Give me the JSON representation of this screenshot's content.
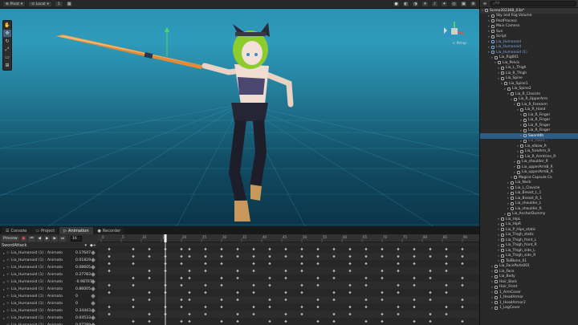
{
  "scene_toolbar": {
    "pivot_label": "Pivot",
    "space_label": "Local",
    "grid_value": "1"
  },
  "scene_view": {
    "perspective_label": "< Persp"
  },
  "anim_tabs": [
    {
      "label": "Console",
      "icon": "console-icon"
    },
    {
      "label": "Project",
      "icon": "folder-icon"
    },
    {
      "label": "Animation",
      "icon": "animation-icon"
    },
    {
      "label": "Recorder",
      "icon": "record-icon"
    }
  ],
  "anim_controls": {
    "preview_label": "Preview",
    "frame_value": "16",
    "clip_name": "SwordAttack"
  },
  "properties": [
    {
      "label": "Lia_Humanoid (1) : Animato",
      "value": "0.17647"
    },
    {
      "label": "Lia_Humanoid (1) : Animato",
      "value": "0.01829"
    },
    {
      "label": "Lia_Humanoid (1) : Animato",
      "value": "0.08605"
    },
    {
      "label": "Lia_Humanoid (1) : Animato",
      "value": "0.27783"
    },
    {
      "label": "Lia_Humanoid (1) : Animato",
      "value": "-0.98707"
    },
    {
      "label": "Lia_Humanoid (1) : Animato",
      "value": "0.86005"
    },
    {
      "label": "Lia_Humanoid (1) : Animato",
      "value": "0"
    },
    {
      "label": "Lia_Humanoid (1) : Animato",
      "value": "0"
    },
    {
      "label": "Lia_Humanoid (1) : Animato",
      "value": "0.34443"
    },
    {
      "label": "Lia_Humanoid (1) : Animato",
      "value": "0.04533"
    },
    {
      "label": "Lia_Humanoid (1) : Animato",
      "value": "0.07289"
    }
  ],
  "timeline": {
    "current_frame": 16,
    "ruler_ticks": [
      "0",
      "5",
      "10",
      "15",
      "20",
      "25",
      "30",
      "35",
      "40",
      "45",
      "50",
      "55",
      "60",
      "65",
      "70",
      "75",
      "80",
      "85",
      "90"
    ]
  },
  "hierarchy": {
    "search_placeholder": "All",
    "items": [
      {
        "label": "Scene20230B_03a*",
        "depth": 0,
        "kind": "scene"
      },
      {
        "label": "Sky and Fog Volume",
        "depth": 2,
        "kind": "normal"
      },
      {
        "label": "PostProcess",
        "depth": 2,
        "kind": "normal"
      },
      {
        "label": "Main Camera",
        "depth": 2,
        "kind": "normal"
      },
      {
        "label": "Sun",
        "depth": 2,
        "kind": "normal"
      },
      {
        "label": "Script",
        "depth": 2,
        "kind": "normal"
      },
      {
        "label": "Lia_Humanoid",
        "depth": 2,
        "kind": "blue"
      },
      {
        "label": "Lia_Humanoid",
        "depth": 2,
        "kind": "blue"
      },
      {
        "label": "Lia_Humanoid (1)",
        "depth": 2,
        "kind": "blue"
      },
      {
        "label": "Lia_Rig001",
        "depth": 3,
        "kind": "normal"
      },
      {
        "label": "Lia_Pelvis",
        "depth": 4,
        "kind": "normal"
      },
      {
        "label": "Lia_L_Thigh",
        "depth": 5,
        "kind": "normal"
      },
      {
        "label": "Lia_R_Thigh",
        "depth": 5,
        "kind": "normal"
      },
      {
        "label": "Lia_Spine",
        "depth": 5,
        "kind": "normal"
      },
      {
        "label": "Lia_Spine1",
        "depth": 6,
        "kind": "normal"
      },
      {
        "label": "Lia_Spine2",
        "depth": 7,
        "kind": "normal"
      },
      {
        "label": "Lia_R_Clavicle",
        "depth": 8,
        "kind": "normal"
      },
      {
        "label": "Lia_R_UpperArm",
        "depth": 9,
        "kind": "normal"
      },
      {
        "label": "Lia_R_Forearm",
        "depth": 10,
        "kind": "normal"
      },
      {
        "label": "Lia_R_Hand",
        "depth": 11,
        "kind": "normal"
      },
      {
        "label": "Lia_R_Finger",
        "depth": 12,
        "kind": "normal"
      },
      {
        "label": "Lia_R_Finger",
        "depth": 12,
        "kind": "normal"
      },
      {
        "label": "Lia_R_Finger",
        "depth": 12,
        "kind": "normal"
      },
      {
        "label": "Lia_R_Finger",
        "depth": 12,
        "kind": "normal"
      },
      {
        "label": "Sword4h",
        "depth": 12,
        "kind": "selected"
      },
      {
        "label": "Lia_Hand...",
        "depth": 12,
        "kind": "dim"
      },
      {
        "label": "Lia_elbow_R",
        "depth": 11,
        "kind": "normal"
      },
      {
        "label": "Lia_foreArm_R",
        "depth": 11,
        "kind": "normal"
      },
      {
        "label": "Lia_R_Armtrine_R",
        "depth": 11,
        "kind": "normal"
      },
      {
        "label": "Lia_shoulder_R",
        "depth": 10,
        "kind": "normal"
      },
      {
        "label": "Lia_upperArmB_R",
        "depth": 10,
        "kind": "normal"
      },
      {
        "label": "Lia_upperArmB_R",
        "depth": 10,
        "kind": "normal"
      },
      {
        "label": "Magica Capsule Co",
        "depth": 9,
        "kind": "normal"
      },
      {
        "label": "Lia_Neck",
        "depth": 8,
        "kind": "normal"
      },
      {
        "label": "Lia_L_Clavicle",
        "depth": 8,
        "kind": "normal"
      },
      {
        "label": "Lia_Breast_L_1",
        "depth": 8,
        "kind": "normal"
      },
      {
        "label": "Lia_Breast_R_1",
        "depth": 8,
        "kind": "normal"
      },
      {
        "label": "Lia_shoulder_L",
        "depth": 8,
        "kind": "normal"
      },
      {
        "label": "Lia_shoulder_R",
        "depth": 8,
        "kind": "normal"
      },
      {
        "label": "Lia_AnchorDummy",
        "depth": 7,
        "kind": "normal"
      },
      {
        "label": "Lia_HipL",
        "depth": 5,
        "kind": "normal"
      },
      {
        "label": "Lia_HipR",
        "depth": 5,
        "kind": "normal"
      },
      {
        "label": "Lia_P_Hips_static",
        "depth": 5,
        "kind": "normal"
      },
      {
        "label": "Lia_Thigh_static",
        "depth": 5,
        "kind": "normal"
      },
      {
        "label": "Lia_Thigh_front_L",
        "depth": 5,
        "kind": "normal"
      },
      {
        "label": "Lia_Thigh_front_R",
        "depth": 5,
        "kind": "normal"
      },
      {
        "label": "Lia_Thigh_side_L",
        "depth": 5,
        "kind": "normal"
      },
      {
        "label": "Lia_Thigh_side_R",
        "depth": 5,
        "kind": "normal"
      },
      {
        "label": "TailBone_01",
        "depth": 5,
        "kind": "normal"
      },
      {
        "label": "Lia_FaceParts001",
        "depth": 3,
        "kind": "normal"
      },
      {
        "label": "Lia_Face",
        "depth": 3,
        "kind": "normal"
      },
      {
        "label": "Lia_Body",
        "depth": 3,
        "kind": "normal"
      },
      {
        "label": "Hair_Back",
        "depth": 3,
        "kind": "normal"
      },
      {
        "label": "Hair_Front",
        "depth": 3,
        "kind": "normal"
      },
      {
        "label": "1_ArmCover",
        "depth": 3,
        "kind": "normal"
      },
      {
        "label": "1_HeadArmor",
        "depth": 3,
        "kind": "normal"
      },
      {
        "label": "1_HeadArmor2",
        "depth": 3,
        "kind": "normal"
      },
      {
        "label": "1_LegCover",
        "depth": 3,
        "kind": "normal"
      }
    ]
  },
  "colors": {
    "selection": "#2c5d87",
    "playhead": "#ffffff",
    "keyframe": "#b8b8b8",
    "sky": "#2f9bbb"
  }
}
